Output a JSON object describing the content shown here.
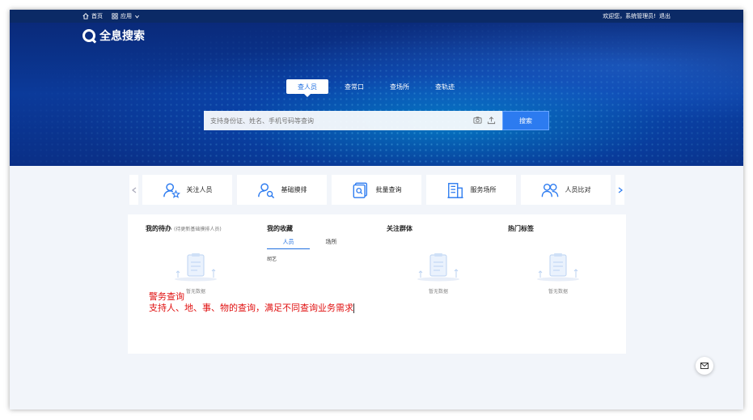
{
  "topbar": {
    "home_label": "首页",
    "apps_label": "应用",
    "welcome": "欢迎您，系统管理员!",
    "logout": "退出"
  },
  "header": {
    "title": "全息搜索"
  },
  "tabs": [
    {
      "label": "查人员",
      "active": true
    },
    {
      "label": "查常口",
      "active": false
    },
    {
      "label": "查场所",
      "active": false
    },
    {
      "label": "查轨迹",
      "active": false
    }
  ],
  "search": {
    "placeholder": "支持身份证、姓名、手机号码等查询",
    "button": "搜索",
    "camera_icon": "camera-icon",
    "upload_icon": "upload-icon"
  },
  "quick_items": [
    {
      "label": "关注人员",
      "icon": "person-star-icon"
    },
    {
      "label": "基础摸排",
      "icon": "person-search-icon"
    },
    {
      "label": "批量查询",
      "icon": "batch-query-icon"
    },
    {
      "label": "服务场所",
      "icon": "building-icon"
    },
    {
      "label": "人员比对",
      "icon": "people-compare-icon"
    }
  ],
  "panels": {
    "todo": {
      "title": "我的待办",
      "subtitle": "(待更新基础摸排人员)",
      "empty": "暂无数据"
    },
    "favorites": {
      "title": "我的收藏",
      "tabs": [
        "人员",
        "场所"
      ],
      "active_tab": 0,
      "entry": "胡艺"
    },
    "groups": {
      "title": "关注群体",
      "empty": "暂无数据"
    },
    "tags": {
      "title": "热门标签",
      "empty": "暂无数据"
    }
  },
  "callout": {
    "line1": "警务查询",
    "line2": "支持人、地、事、物的查询，满足不同查询业务需求"
  },
  "colors": {
    "accent": "#2c7bf0",
    "topbar": "#0b2a66",
    "callout": "#e01010"
  }
}
